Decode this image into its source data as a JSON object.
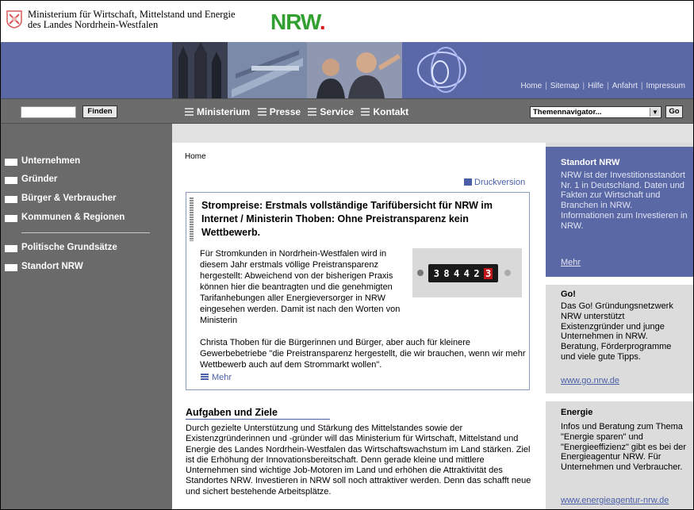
{
  "header": {
    "ministry_line1": "Ministerium für Wirtschaft, Mittelstand und Energie",
    "ministry_line2": "des Landes Nordrhein-Westfalen",
    "logo_text": "NRW",
    "logo_dot": "."
  },
  "topnav": [
    "Home",
    "Sitemap",
    "Hilfe",
    "Anfahrt",
    "Impressum"
  ],
  "search": {
    "placeholder": "",
    "button_label": "Finden"
  },
  "mainnav": [
    "Ministerium",
    "Presse",
    "Service",
    "Kontakt"
  ],
  "themen": {
    "selected": "Themennavigator...",
    "go_label": "Go"
  },
  "sidebar": {
    "items": [
      "Unternehmen",
      "Gründer",
      "Bürger & Verbraucher",
      "Kommunen & Regionen",
      "Politische Grundsätze",
      "Standort NRW"
    ]
  },
  "breadcrumb": "Home",
  "druckversion": "Druckversion",
  "featured": {
    "title": "Strompreise: Erstmals vollständige Tarifübersicht für NRW im Internet / Ministerin Thoben: Ohne Preistransparenz kein Wettbewerb.",
    "text1": "Für Stromkunden in Nordrhein-Westfalen wird in diesem Jahr erstmals völlige Preistransparenz hergestellt: Abweichend von der bisherigen Praxis können hier die beantragten und die genehmigten Tarifanhebungen aller Energieversorger in NRW eingesehen werden. Damit ist nach den Worten von Ministerin",
    "text2": "Christa Thoben für die Bürgerinnen und Bürger, aber auch für kleinere Gewerbebetriebe \"die Preistransparenz hergestellt, die wir brauchen, wenn wir mehr Wettbewerb auch auf dem Strommarkt wollen\".",
    "meter_digits": [
      "3",
      "8",
      "4",
      "4",
      "2",
      "3"
    ],
    "mehr": "Mehr"
  },
  "aufgaben": {
    "title": "Aufgaben und Ziele",
    "text": "Durch gezielte Unterstützung und Stärkung des Mittelstandes sowie der Existenzgründerinnen und -gründer will das Ministerium für Wirtschaft, Mittelstand und Energie des Landes Nordrhein-Westfalen das Wirtschaftswachstum im Land stärken. Ziel ist die Erhöhung der Innovationsbereitschaft. Denn gerade kleine und mittlere Unternehmen sind wichtige Job-Motoren im Land und erhöhen die Attraktivität des Standortes NRW. Investieren in NRW soll noch attraktiver werden. Denn das schafft neue und sichert bestehende Arbeitsplätze."
  },
  "right": {
    "standort": {
      "title": "Standort NRW",
      "text": "NRW ist der Investitionsstandort Nr. 1 in Deutschland. Daten und Fakten zur Wirtschaft und Branchen in NRW. Informationen zum Investieren in NRW.",
      "link": "Mehr"
    },
    "go": {
      "title": "Go!",
      "text": "Das Go! Gründungsnetzwerk NRW unterstützt Existenzgründer und junge Unternehmen in NRW. Beratung, Förderprogramme und viele gute Tipps.",
      "link": "www.go.nrw.de"
    },
    "energie": {
      "title": "Energie",
      "text": "Infos und Beratung zum Thema \"Energie sparen\" und \"Energieeffizienz\" gibt es bei der Energieagentur NRW. Für Unternehmen und Verbraucher.",
      "link": "www.energieagentur-nrw.de"
    }
  },
  "colors": {
    "banner_blue": "#5b68a6",
    "sidebar_gray": "#6a6a6a",
    "link_blue": "#4a5fa8",
    "nrw_green": "#31a030",
    "nrw_red": "#d61a1a"
  }
}
